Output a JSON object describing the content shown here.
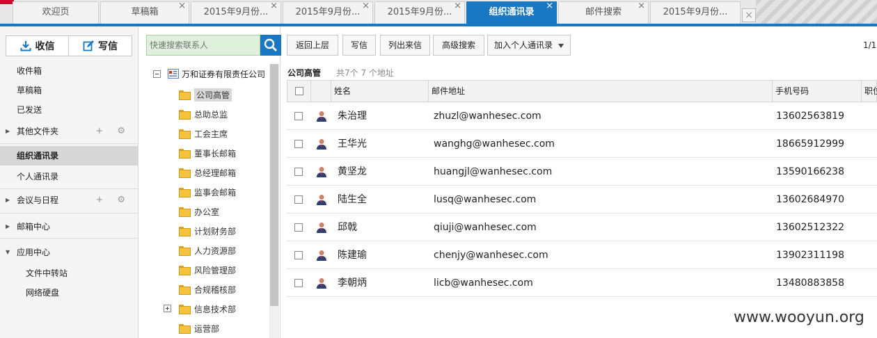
{
  "tabs": [
    {
      "label": "欢迎页",
      "left": 0
    },
    {
      "label": "草稿箱",
      "closable": true
    },
    {
      "label": "2015年9月份...",
      "closable": true
    },
    {
      "label": "2015年9月份...",
      "closable": true
    },
    {
      "label": "2015年9月份...",
      "closable": true
    },
    {
      "label": "组织通讯录",
      "closable": true,
      "active": true
    },
    {
      "label": "邮件搜索",
      "closable": true
    },
    {
      "label": "2015年9月份...",
      "closable": true
    }
  ],
  "tab_close_glyph": "×",
  "sidebar": {
    "receive_label": "收信",
    "write_label": "写信",
    "items": [
      {
        "label": "收件箱"
      },
      {
        "label": "草稿箱"
      },
      {
        "label": "已发送"
      },
      {
        "label": "其他文件夹",
        "arrow": "▶",
        "tools": "+ ⚙"
      },
      {
        "label": "组织通讯录",
        "active": true
      },
      {
        "label": "个人通讯录"
      },
      {
        "label": "会议与日程",
        "arrow": "▶",
        "tools": "+ ⚙"
      },
      {
        "label": "邮箱中心",
        "arrow": "▶"
      },
      {
        "label": "应用中心",
        "arrow": "▼"
      },
      {
        "label": "文件中转站",
        "sub": true
      },
      {
        "label": "网络硬盘",
        "sub": true
      }
    ]
  },
  "tree": {
    "search_placeholder": "快速搜索联系人",
    "root_label": "万和证券有限责任公司",
    "nodes": [
      {
        "label": "公司高管",
        "selected": true
      },
      {
        "label": "总助总监"
      },
      {
        "label": "工会主席"
      },
      {
        "label": "董事长邮箱"
      },
      {
        "label": "总经理邮箱"
      },
      {
        "label": "监事会邮箱"
      },
      {
        "label": "办公室"
      },
      {
        "label": "计划财务部"
      },
      {
        "label": "人力资源部"
      },
      {
        "label": "风险管理部"
      },
      {
        "label": "合规稽核部"
      },
      {
        "label": "信息技术部",
        "expandable": true
      },
      {
        "label": "运营部"
      }
    ]
  },
  "toolbar": {
    "back_label": "返回上层",
    "write_label": "写信",
    "list_label": "列出来信",
    "advanced_label": "高级搜索",
    "add_label": "加入个人通讯录",
    "pager": "1/1"
  },
  "group": {
    "title": "公司高管",
    "count": "共7个 7 个地址"
  },
  "table": {
    "headers": {
      "name": "姓名",
      "email": "邮件地址",
      "phone": "手机号码",
      "position": "职位"
    },
    "rows": [
      {
        "name": "朱治理",
        "email": "zhuzl@wanhesec.com",
        "phone": "13602563819"
      },
      {
        "name": "王华光",
        "email": "wanghg@wanhesec.com",
        "phone": "18665912999"
      },
      {
        "name": "黄坚龙",
        "email": "huangjl@wanhesec.com",
        "phone": "13590166238"
      },
      {
        "name": "陆生全",
        "email": "lusq@wanhesec.com",
        "phone": "13602684970"
      },
      {
        "name": "邱戟",
        "email": "qiuji@wanhesec.com",
        "phone": "13602512322"
      },
      {
        "name": "陈建瑜",
        "email": "chenjy@wanhesec.com",
        "phone": "13902311198"
      },
      {
        "name": "李朝炳",
        "email": "licb@wanhesec.com",
        "phone": "13480883858"
      }
    ]
  },
  "watermark": "www.wooyun.org",
  "colors": {
    "accent": "#1a78c2",
    "search_bg": "#dff0dc",
    "folder": "#f5c342",
    "selected_bg": "#d6d6d6"
  }
}
